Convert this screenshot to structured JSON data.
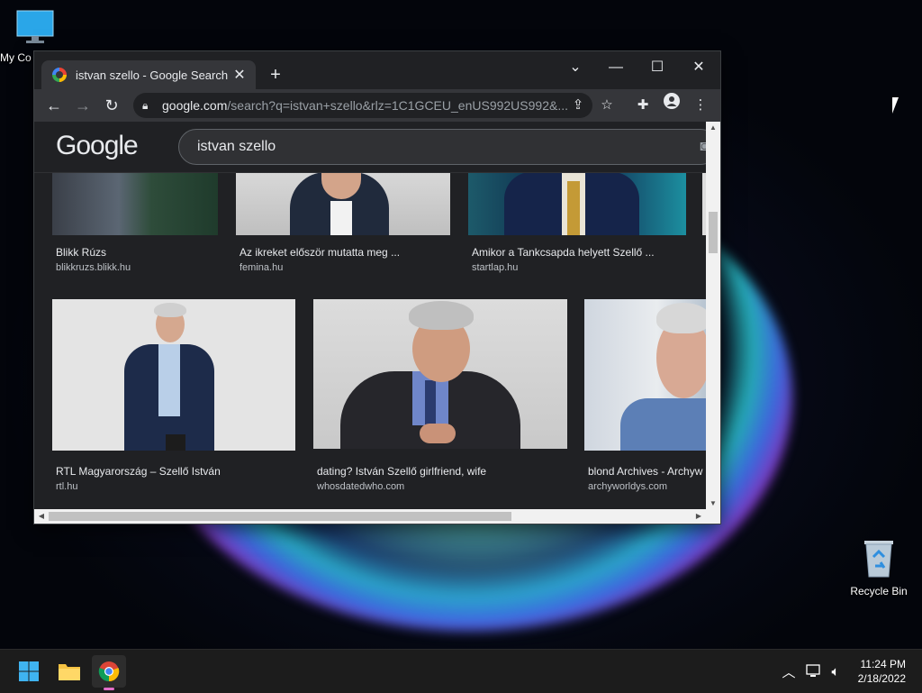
{
  "desktop": {
    "icons": [
      {
        "label": "My Co"
      },
      {
        "label": "Recycle Bin"
      }
    ]
  },
  "browser": {
    "tab_title": "istvan szello - Google Search",
    "tab_close": "✕",
    "new_tab": "+",
    "window_controls": {
      "dropdown": "⌄",
      "minimize": "—",
      "maximize": "☐",
      "close": "✕"
    },
    "url_host": "google.com",
    "url_path": "/search?q=istvan+szello&rlz=1C1GCEU_enUS992US992&..."
  },
  "search": {
    "logo": "Google",
    "query": "istvan szello"
  },
  "results": [
    {
      "caption": "Blikk Rúzs",
      "source": "blikkruzs.blikk.hu"
    },
    {
      "caption": "Az ikreket először mutatta meg ...",
      "source": "femina.hu"
    },
    {
      "caption": "Amikor a Tankcsapda helyett Szellő ...",
      "source": "startlap.hu"
    },
    {
      "caption": "RTL Magyarország – Szellő István",
      "source": "rtl.hu"
    },
    {
      "caption": "dating? István Szellő girlfriend, wife",
      "source": "whosdatedwho.com"
    },
    {
      "caption": "blond Archives - Archyw",
      "source": "archyworldys.com"
    }
  ],
  "taskbar": {
    "time": "11:24 PM",
    "date": "2/18/2022"
  },
  "colors": {
    "chrome_dark": "#202124",
    "toolbar": "#35363a",
    "text": "#e8eaed"
  }
}
